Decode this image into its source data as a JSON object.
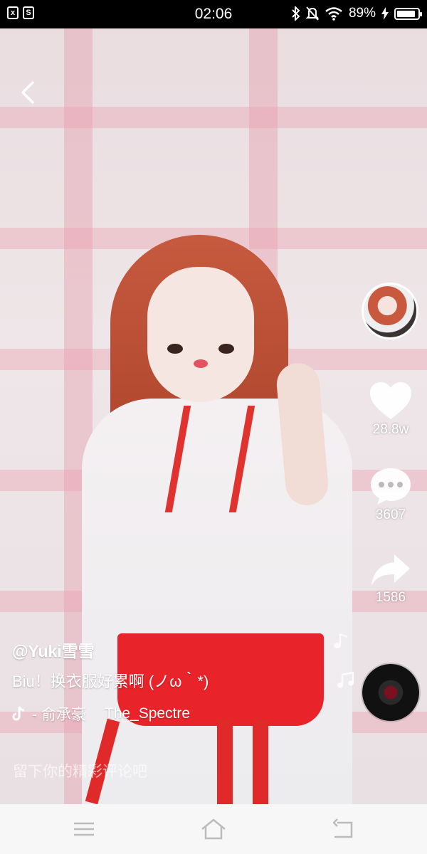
{
  "status_bar": {
    "time": "02:06",
    "battery_text": "89%",
    "battery_level": 0.89,
    "icons": [
      "app-icon-x",
      "app-icon-s",
      "bluetooth-icon",
      "mute-bell-icon",
      "wifi-icon",
      "charging-icon",
      "battery-icon"
    ]
  },
  "video": {
    "back_icon": "chevron-left-icon"
  },
  "rail": {
    "likes": "28.8w",
    "comments": "3607",
    "shares": "1586"
  },
  "caption": {
    "username": "@Yuki雪雪",
    "description": "Biu！换衣服好累啊 (ノω｀*)",
    "music_artist": "- 俞承豪",
    "music_title": "The_Spectre"
  },
  "comment_input": {
    "placeholder": "留下你的精彩评论吧"
  },
  "navbar": {
    "icons": [
      "menu-icon",
      "home-icon",
      "back-icon"
    ]
  },
  "colors": {
    "accent_red": "#e8242a",
    "navbar_bg": "#f7f7f7"
  }
}
